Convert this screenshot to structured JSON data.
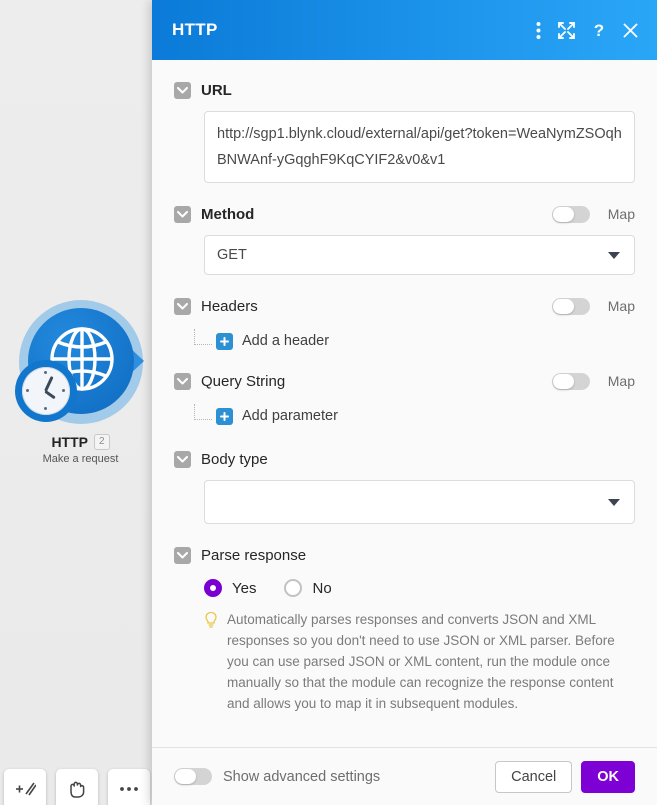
{
  "canvas": {
    "module": {
      "icon": "globe-clock-icon",
      "title": "HTTP",
      "badge": "2",
      "subtitle": "Make a request"
    },
    "toolbar": [
      {
        "name": "add-module-tool",
        "glyph": "+⁄⁄"
      },
      {
        "name": "pan-hand-tool",
        "glyph": "hand"
      },
      {
        "name": "more-options-tool",
        "glyph": "…"
      }
    ]
  },
  "panel": {
    "title": "HTTP",
    "header_actions": [
      {
        "name": "menu-dots-icon",
        "label": "⋮"
      },
      {
        "name": "expand-icon",
        "label": "expand"
      },
      {
        "name": "help-icon",
        "label": "?"
      },
      {
        "name": "close-icon",
        "label": "✕"
      }
    ],
    "sections": {
      "url": {
        "label": "URL",
        "value": "http://sgp1.blynk.cloud/external/api/get?token=WeaNymZSOqhBNWAnf-yGqghF9KqCYIF2&v0&v1"
      },
      "method": {
        "label": "Method",
        "map_label": "Map",
        "map_on": false,
        "value": "GET"
      },
      "headers": {
        "label": "Headers",
        "map_label": "Map",
        "map_on": false,
        "add_label": "Add a header"
      },
      "query_string": {
        "label": "Query String",
        "map_label": "Map",
        "map_on": false,
        "add_label": "Add parameter"
      },
      "body_type": {
        "label": "Body type",
        "value": ""
      },
      "parse_response": {
        "label": "Parse response",
        "options": [
          {
            "label": "Yes",
            "selected": true
          },
          {
            "label": "No",
            "selected": false
          }
        ],
        "hint": "Automatically parses responses and converts JSON and XML responses so you don't need to use JSON or XML parser. Before you can use parsed JSON or XML content, run the module once manually so that the module can recognize the response content and allows you to map it in subsequent modules."
      }
    },
    "footer": {
      "advanced_label": "Show advanced settings",
      "advanced_on": false,
      "cancel_label": "Cancel",
      "ok_label": "OK"
    }
  },
  "colors": {
    "header_blue_start": "#0b7ad8",
    "header_blue_end": "#2aa6f7",
    "accent_purple": "#7d00d4",
    "plus_blue": "#2d90d2",
    "canvas_gray": "#ececec"
  }
}
